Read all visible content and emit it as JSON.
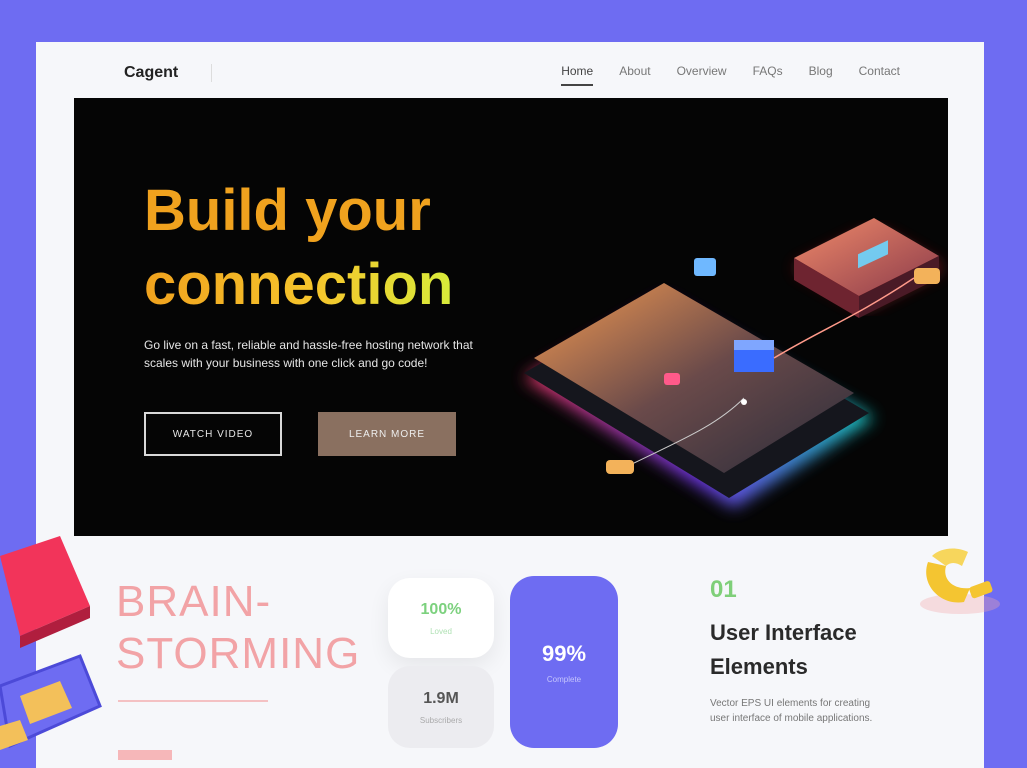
{
  "nav": {
    "logo": "Cagent",
    "items": [
      {
        "label": "Home",
        "active": true
      },
      {
        "label": "About"
      },
      {
        "label": "Overview"
      },
      {
        "label": "FAQs"
      },
      {
        "label": "Blog"
      },
      {
        "label": "Contact"
      }
    ]
  },
  "hero": {
    "title_line1": "Build your",
    "title_line2": "connection",
    "description": "Go live on a fast, reliable and hassle-free hosting network that scales with your business with one click and go code!",
    "btn_outline": "WATCH VIDEO",
    "btn_solid": "LEARN MORE"
  },
  "brainstorm": {
    "line1": "BRAIN-",
    "line2": "STORMING"
  },
  "stats": [
    {
      "value": "100%",
      "label": "Loved"
    },
    {
      "value": "1.9M",
      "label": "Subscribers"
    },
    {
      "value": "99%",
      "label": "Complete"
    }
  ],
  "feature": {
    "number": "01",
    "title": "User Interface Elements",
    "description": "Vector EPS UI elements for creating user interface of mobile applications."
  },
  "colors": {
    "page_bg": "#6e6cf2",
    "accent_purple": "#6e6cf2",
    "hero_title": "#f0a21e",
    "brainstorm": "#f2a3a6",
    "green": "#7fcf79"
  }
}
